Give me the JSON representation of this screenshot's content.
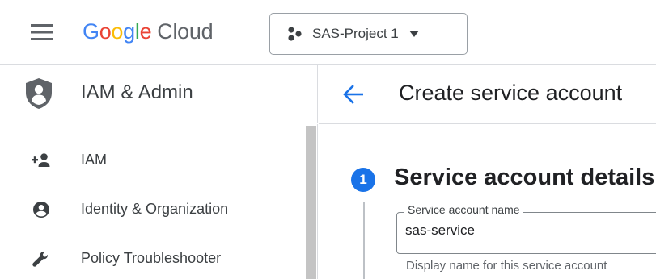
{
  "header": {
    "logo_google": [
      "G",
      "o",
      "o",
      "g",
      "l",
      "e"
    ],
    "logo_product": "Cloud",
    "project_name": "SAS-Project 1"
  },
  "sidebar": {
    "title": "IAM & Admin",
    "items": [
      {
        "label": "IAM",
        "icon": "person-add-icon"
      },
      {
        "label": "Identity & Organization",
        "icon": "account-circle-icon"
      },
      {
        "label": "Policy Troubleshooter",
        "icon": "wrench-icon"
      }
    ]
  },
  "main": {
    "title": "Create service account",
    "step": {
      "number": "1",
      "title": "Service account details"
    },
    "service_account_name": {
      "label": "Service account name",
      "value": "sas-service",
      "hint": "Display name for this service account"
    }
  },
  "colors": {
    "accent": "#1a73e8",
    "google_blue": "#4285F4",
    "google_red": "#EA4335",
    "google_yellow": "#FBBC05",
    "google_green": "#34A853",
    "scrollbar": "#c4c4c4"
  }
}
